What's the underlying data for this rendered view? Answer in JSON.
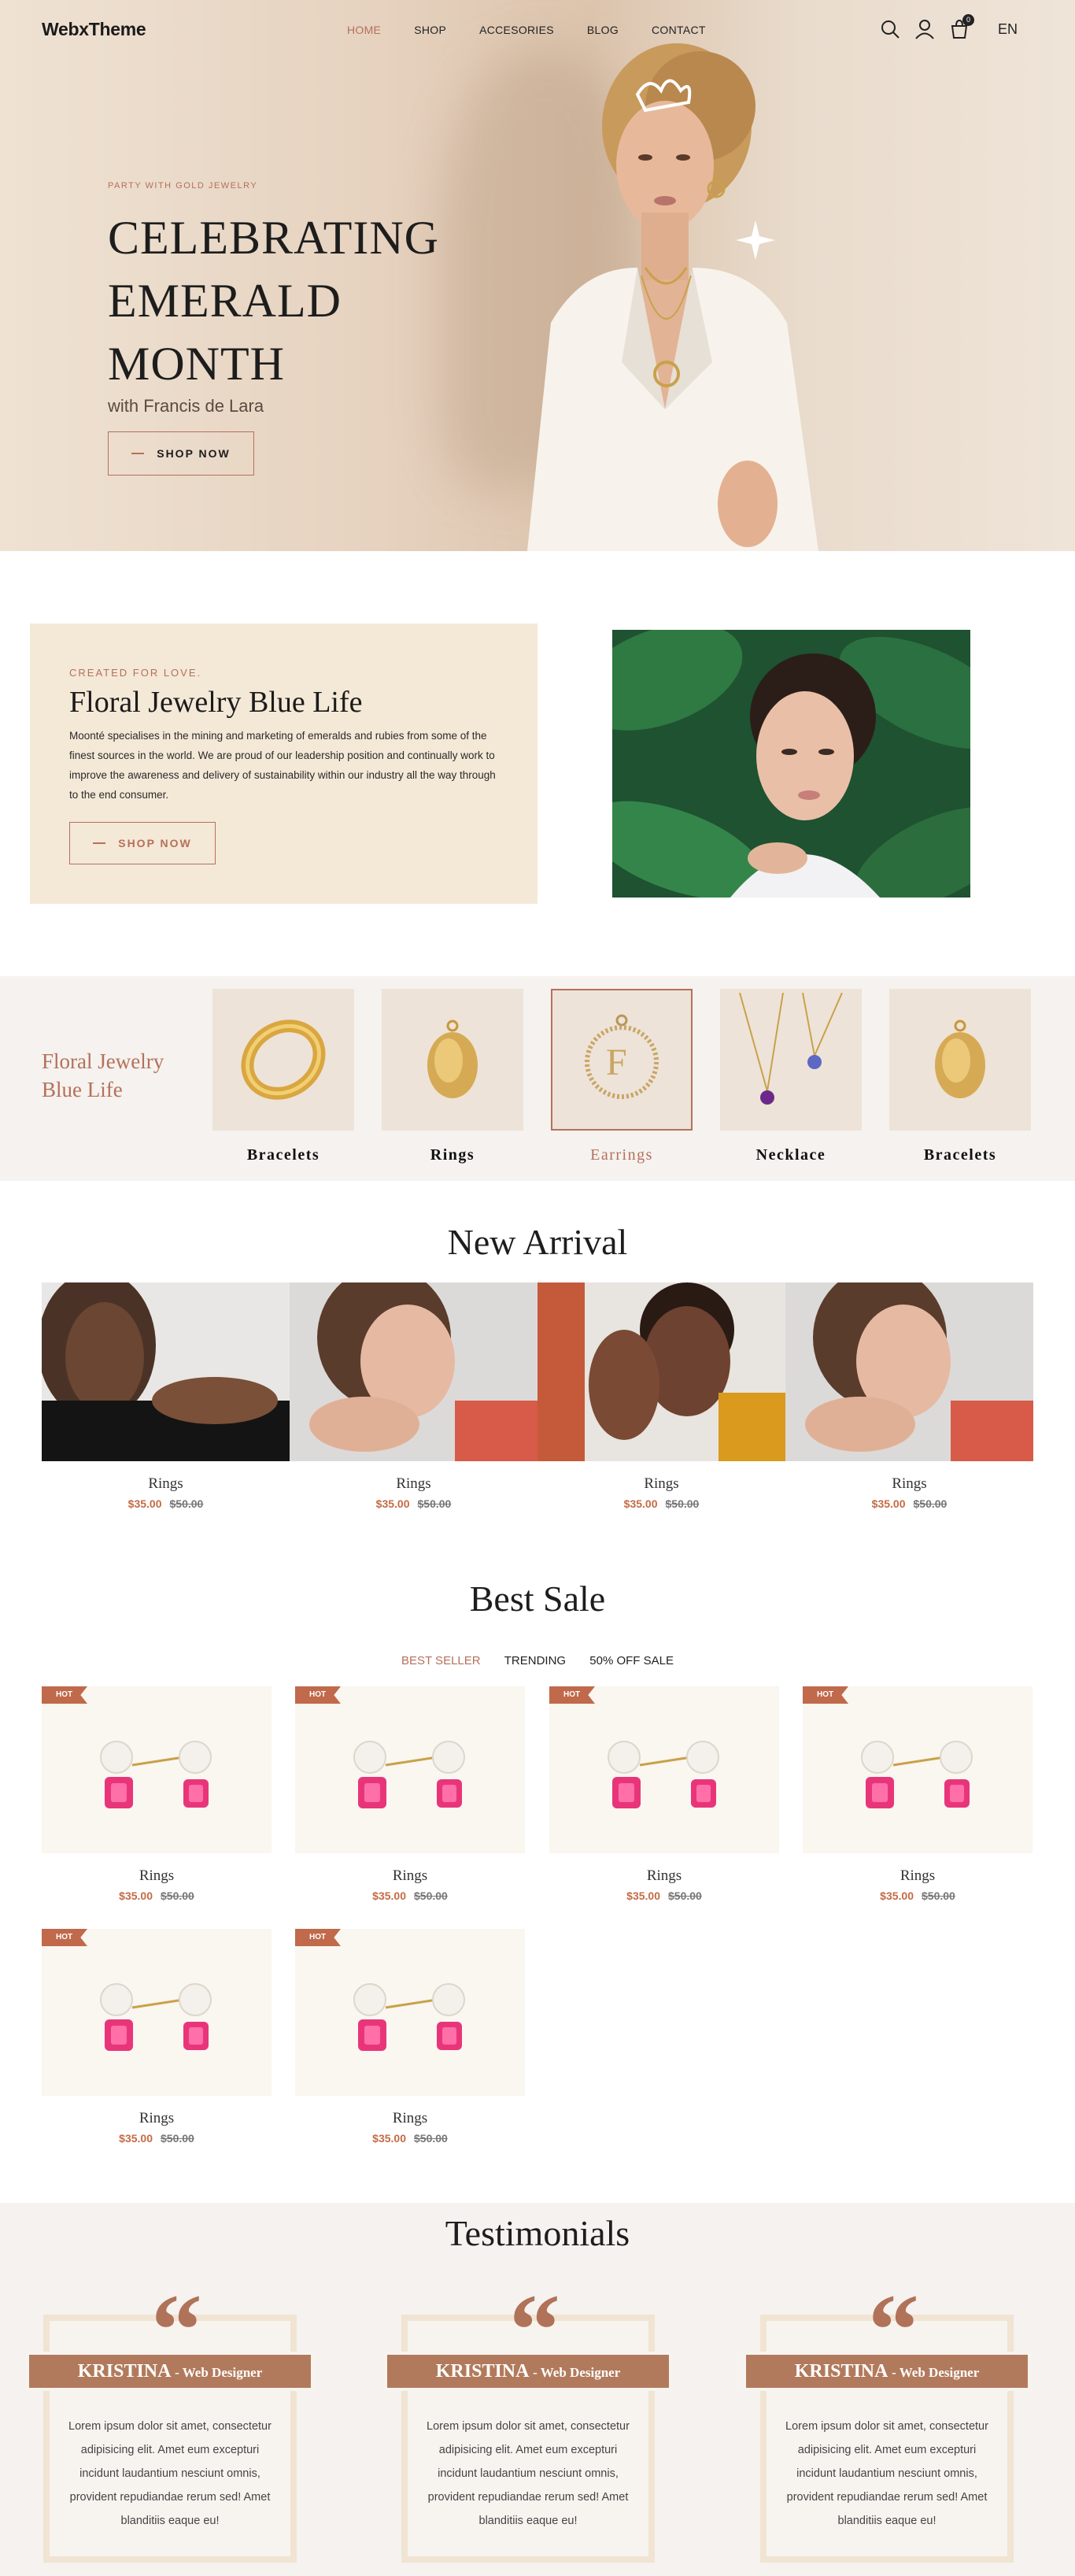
{
  "header": {
    "logo": "WebxTheme",
    "nav": [
      "HOME",
      "SHOP",
      "ACCESORIES",
      "BLOG",
      "CONTACT"
    ],
    "active_nav": "HOME",
    "cart_count": "0",
    "language": "EN",
    "icons": [
      "search-icon",
      "user-icon",
      "cart-icon"
    ]
  },
  "hero": {
    "kicker": "PARTY WITH GOLD JEWELRY",
    "title": "CELEBRATING EMERALD MONTH",
    "subtitle": "with Francis de Lara",
    "button": "SHOP NOW"
  },
  "intro": {
    "kicker": "CREATED FOR LOVE.",
    "title": "Floral Jewelry Blue Life",
    "body": "Moonté specialises in the mining and marketing of emeralds and rubies from some of the finest sources in the world. We are proud of our leadership position and continually work to improve the awareness and delivery of sustainability within our industry all the way through to the end consumer.",
    "button": "SHOP NOW"
  },
  "categories": {
    "title": "Floral Jewelry Blue Life",
    "items": [
      {
        "label": "Bracelets",
        "icon": "gold-band-ring-icon"
      },
      {
        "label": "Rings",
        "icon": "oval-pendant-icon"
      },
      {
        "label": "Earrings",
        "icon": "letter-medallion-icon",
        "selected": true
      },
      {
        "label": "Necklace",
        "icon": "gemstone-necklace-icon"
      },
      {
        "label": "Bracelets",
        "icon": "oval-pendant-icon"
      }
    ]
  },
  "new_arrival": {
    "title": "New Arrival",
    "products": [
      {
        "name": "Rings",
        "price": "$35.00",
        "old_price": "$50.00"
      },
      {
        "name": "Rings",
        "price": "$35.00",
        "old_price": "$50.00"
      },
      {
        "name": "Rings",
        "price": "$35.00",
        "old_price": "$50.00"
      },
      {
        "name": "Rings",
        "price": "$35.00",
        "old_price": "$50.00"
      }
    ]
  },
  "best_sale": {
    "title": "Best Sale",
    "tabs": [
      "BEST SELLER",
      "TRENDING",
      "50% OFF SALE"
    ],
    "active_tab": "BEST SELLER",
    "badge": "HOT",
    "products": [
      {
        "name": "Rings",
        "price": "$35.00",
        "old_price": "$50.00"
      },
      {
        "name": "Rings",
        "price": "$35.00",
        "old_price": "$50.00"
      },
      {
        "name": "Rings",
        "price": "$35.00",
        "old_price": "$50.00"
      },
      {
        "name": "Rings",
        "price": "$35.00",
        "old_price": "$50.00"
      },
      {
        "name": "Rings",
        "price": "$35.00",
        "old_price": "$50.00"
      },
      {
        "name": "Rings",
        "price": "$35.00",
        "old_price": "$50.00"
      }
    ]
  },
  "testimonials": {
    "title": "Testimonials",
    "items": [
      {
        "name": "KRISTINA",
        "role": "- Web Designer",
        "text": "Lorem ipsum dolor sit amet, consectetur adipisicing elit. Amet eum excepturi incidunt laudantium nesciunt omnis, provident repudiandae rerum sed! Amet blanditiis eaque eu!"
      },
      {
        "name": "KRISTINA",
        "role": "- Web Designer",
        "text": "Lorem ipsum dolor sit amet, consectetur adipisicing elit. Amet eum excepturi incidunt laudantium nesciunt omnis, provident repudiandae rerum sed! Amet blanditiis eaque eu!"
      },
      {
        "name": "KRISTINA",
        "role": "- Web Designer",
        "text": "Lorem ipsum dolor sit amet, consectetur adipisicing elit. Amet eum excepturi incidunt laudantium nesciunt omnis, provident repudiandae rerum sed! Amet blanditiis eaque eu!"
      }
    ]
  },
  "colors": {
    "accent": "#b5705a",
    "price": "#c46b45",
    "cream": "#f4e8d7",
    "band": "#f5f2ef"
  }
}
